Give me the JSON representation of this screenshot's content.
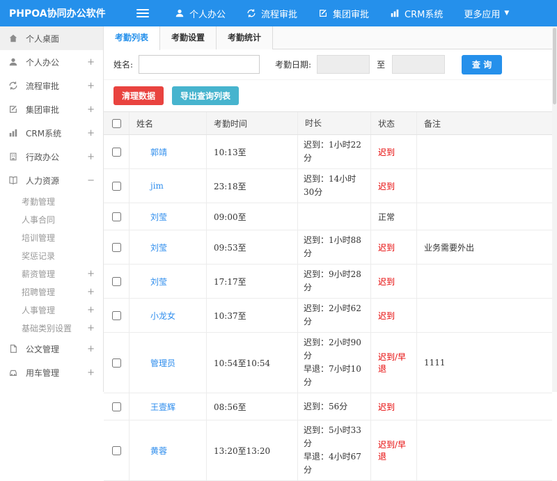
{
  "header": {
    "brand": "PHPOA协同办公软件",
    "nav": [
      {
        "label": "个人办公",
        "icon": "user-icon"
      },
      {
        "label": "流程审批",
        "icon": "sync-icon"
      },
      {
        "label": "集团审批",
        "icon": "edit-icon"
      },
      {
        "label": "CRM系统",
        "icon": "chart-icon"
      },
      {
        "label": "更多应用",
        "icon": "caret-down-icon",
        "caret": "▼"
      }
    ]
  },
  "sidebar": {
    "items_top": [
      {
        "label": "个人桌面",
        "expand": ""
      },
      {
        "label": "个人办公",
        "expand": "+"
      },
      {
        "label": "流程审批",
        "expand": "+"
      },
      {
        "label": "集团审批",
        "expand": "+"
      },
      {
        "label": "CRM系统",
        "expand": "+"
      },
      {
        "label": "行政办公",
        "expand": "+"
      },
      {
        "label": "人力资源",
        "expand": "−"
      }
    ],
    "hr_submenu": [
      {
        "label": "考勤管理",
        "expand": ""
      },
      {
        "label": "人事合同",
        "expand": ""
      },
      {
        "label": "培训管理",
        "expand": ""
      },
      {
        "label": "奖惩记录",
        "expand": ""
      },
      {
        "label": "薪资管理",
        "expand": "+"
      },
      {
        "label": "招聘管理",
        "expand": "+"
      },
      {
        "label": "人事管理",
        "expand": "+"
      },
      {
        "label": "基础类别设置",
        "expand": "+"
      }
    ],
    "items_bottom": [
      {
        "label": "公文管理",
        "expand": "+"
      },
      {
        "label": "用车管理",
        "expand": "+"
      }
    ]
  },
  "tabs": [
    {
      "label": "考勤列表",
      "active": true
    },
    {
      "label": "考勤设置",
      "active": false
    },
    {
      "label": "考勤统计",
      "active": false
    }
  ],
  "filter": {
    "name_label": "姓名:",
    "name_value": "",
    "date_label": "考勤日期:",
    "date_from": "",
    "to_label": "至",
    "date_to": "",
    "search_button": "查 询"
  },
  "actions": {
    "clean_button": "清理数据",
    "export_button": "导出查询列表"
  },
  "table": {
    "headers": {
      "name": "姓名",
      "time": "考勤时间",
      "duration": "时长",
      "status": "状态",
      "remark": "备注"
    },
    "rows": [
      {
        "name": "郭靖",
        "time": "10:13至",
        "late": "迟到：1小时22分",
        "early": "",
        "status": "迟到",
        "status_class": "st-red",
        "remark": ""
      },
      {
        "name": "jim",
        "time": "23:18至",
        "late": "迟到：14小时30分",
        "early": "",
        "status": "迟到",
        "status_class": "st-red",
        "remark": ""
      },
      {
        "name": "刘莹",
        "time": "09:00至",
        "late": "",
        "early": "",
        "status": "正常",
        "status_class": "st-normal",
        "remark": ""
      },
      {
        "name": "刘莹",
        "time": "09:53至",
        "late": "迟到：1小时88分",
        "early": "",
        "status": "迟到",
        "status_class": "st-red",
        "remark": "业务需要外出"
      },
      {
        "name": "刘莹",
        "time": "17:17至",
        "late": "迟到：9小时28分",
        "early": "",
        "status": "迟到",
        "status_class": "st-red",
        "remark": ""
      },
      {
        "name": "小龙女",
        "time": "10:37至",
        "late": "迟到：2小时62分",
        "early": "",
        "status": "迟到",
        "status_class": "st-red",
        "remark": ""
      },
      {
        "name": "管理员",
        "time": "10:54至10:54",
        "late": "迟到：2小时90分",
        "early": "早退：7小时10分",
        "status": "迟到/早退",
        "status_class": "st-red",
        "remark": "1111"
      },
      {
        "name": "王壹辉",
        "time": "08:56至",
        "late": "迟到：56分",
        "early": "",
        "status": "迟到",
        "status_class": "st-red",
        "remark": ""
      },
      {
        "name": "黄蓉",
        "time": "13:20至13:20",
        "late": "迟到：5小时33分",
        "early": "早退：4小时67分",
        "status": "迟到/早退",
        "status_class": "st-red",
        "remark": ""
      }
    ]
  },
  "colors": {
    "header_blue": "#2590eb",
    "link_blue": "#2e8ded",
    "danger_red": "#e9433f",
    "export_teal": "#47b4ce",
    "status_red": "#e60000"
  }
}
